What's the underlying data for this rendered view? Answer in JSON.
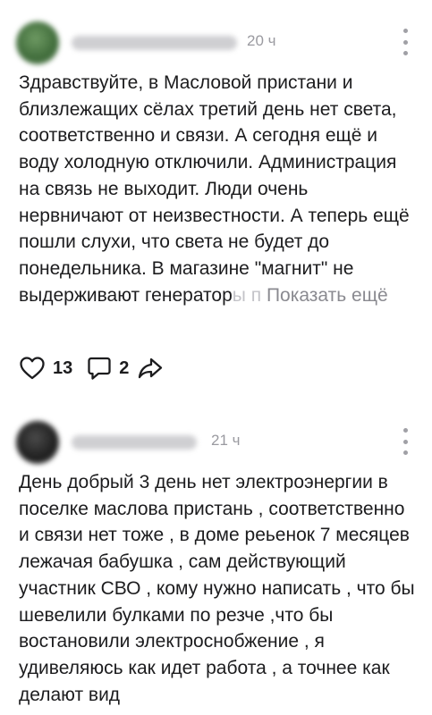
{
  "posts": [
    {
      "time": "20 ч",
      "text_main": "Здравствуйте, в Масловой пристани и близлежащих сёлах третий день нет света, соответственно и связи. А сегодня ещё и воду холодную отключили. Администрация на связь не выходит. Люди очень нервничают от неизвестности. А теперь ещё пошли слухи, что света не будет до понедельника. В магазине \"магнит\" не выдерживают генератор",
      "text_fade": "ы п",
      "show_more": "Показать ещё",
      "likes": "13",
      "comments": "2",
      "icons": [
        "heart-icon",
        "comment-icon",
        "share-icon"
      ]
    },
    {
      "time": "21 ч",
      "text_main": "День добрый 3 день нет электроэнергии в поселке маслова пристань , соответственно и связи нет тоже , в доме реьенок 7 месяцев лежачая бабушка , сам действующий участник СВО , кому нужно написать , что бы шевелили булками по резче ,что бы востановили электроснобжение , я удивеляюсь как идет работа , а точнее как делают вид"
    }
  ]
}
